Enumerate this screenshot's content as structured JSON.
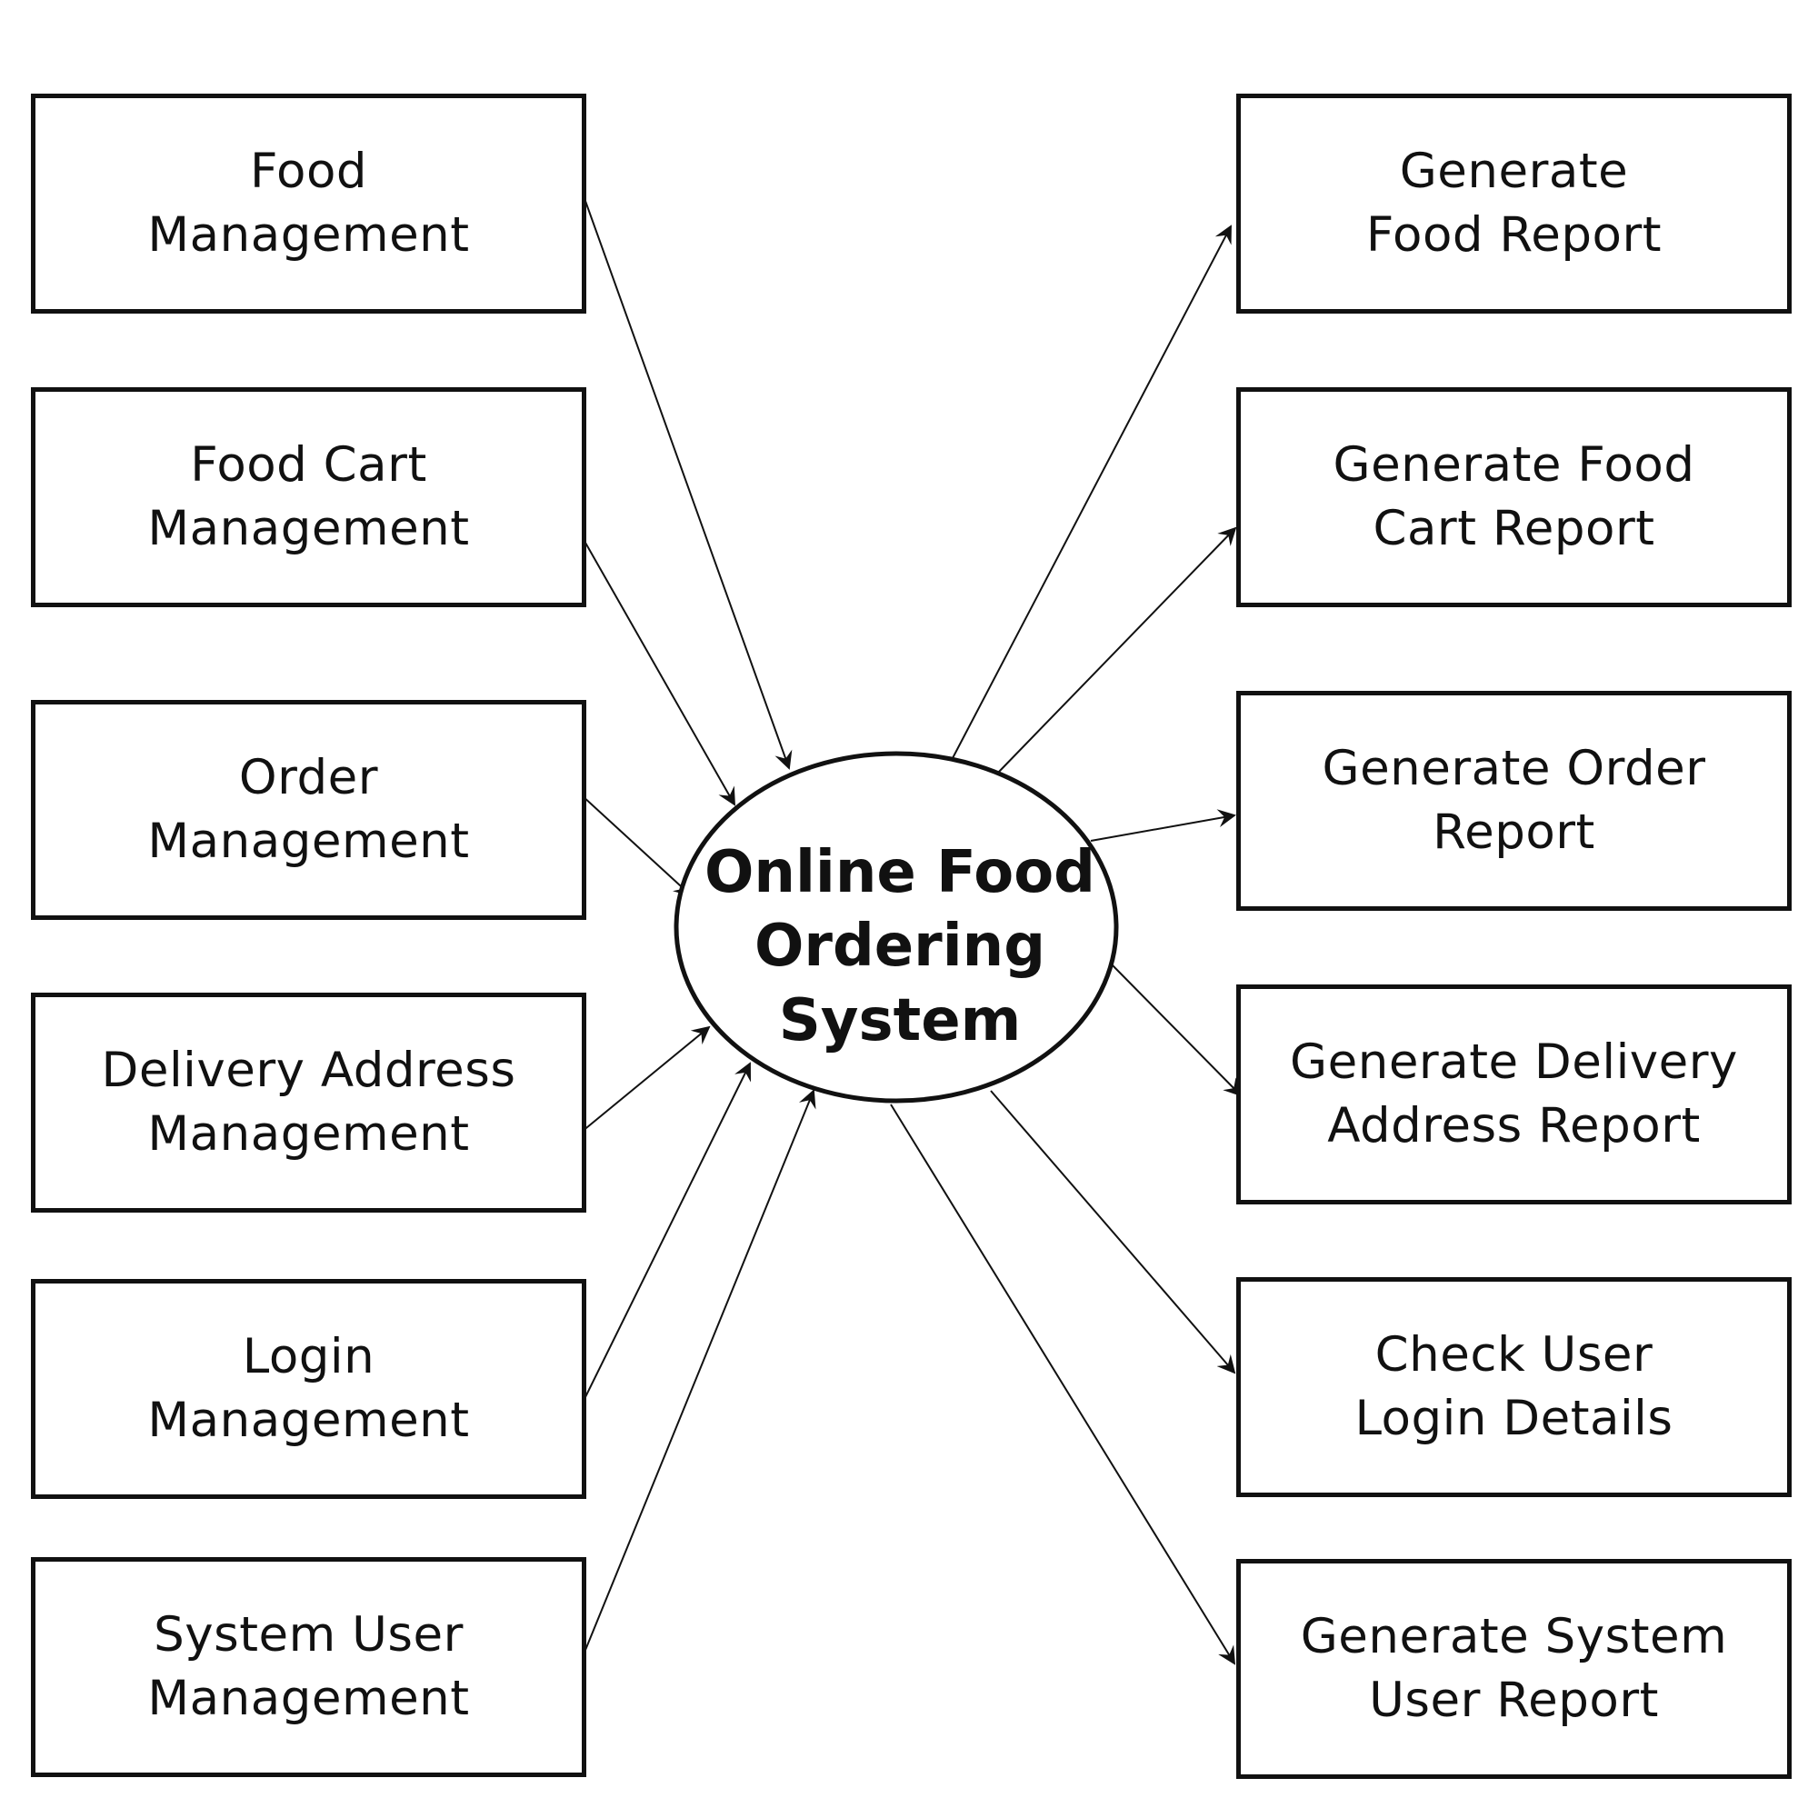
{
  "center_process": {
    "label": "Online Food\nOrdering\nSystem"
  },
  "inputs": [
    {
      "id": "food-management",
      "label": "Food\nManagement"
    },
    {
      "id": "food-cart-management",
      "label": "Food Cart\nManagement"
    },
    {
      "id": "order-management",
      "label": "Order\nManagement"
    },
    {
      "id": "delivery-address-management",
      "label": "Delivery Address\nManagement"
    },
    {
      "id": "login-management",
      "label": "Login\nManagement"
    },
    {
      "id": "system-user-management",
      "label": "System User\nManagement"
    }
  ],
  "outputs": [
    {
      "id": "generate-food-report",
      "label": "Generate\nFood Report"
    },
    {
      "id": "generate-food-cart-report",
      "label": "Generate Food\nCart Report"
    },
    {
      "id": "generate-order-report",
      "label": "Generate Order\nReport"
    },
    {
      "id": "generate-delivery-address-report",
      "label": "Generate Delivery\nAddress Report"
    },
    {
      "id": "check-user-login-details",
      "label": "Check User\nLogin Details"
    },
    {
      "id": "generate-system-user-report",
      "label": "Generate System\nUser Report"
    }
  ],
  "colors": {
    "stroke": "#111111",
    "background": "#ffffff"
  }
}
